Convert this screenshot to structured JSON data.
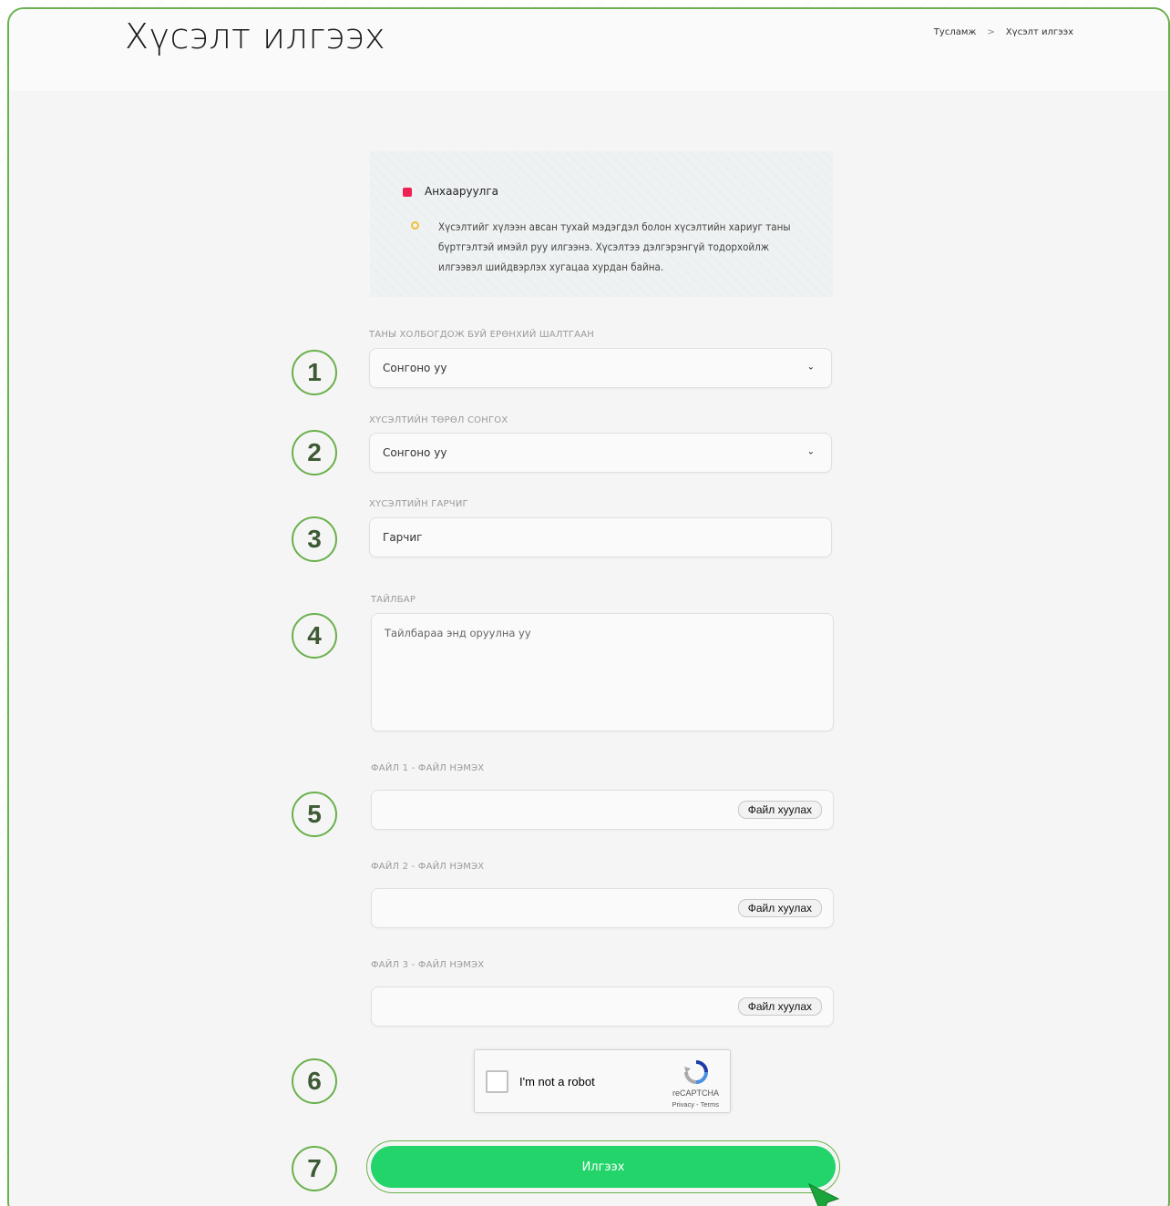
{
  "header": {
    "title": "Хүсэлт илгээх",
    "breadcrumb": {
      "home": "Тусламж",
      "current": "Хүсэлт илгээх"
    }
  },
  "notice": {
    "title": "Анхааруулга",
    "text": "Хүсэлтийг хүлээн авсан тухай мэдэгдэл болон хүсэлтийн хариуг таны бүртгэлтэй имэйл руу илгээнэ. Хүсэлтээ дэлгэрэнгүй тодорхойлж илгээвэл шийдвэрлэх хугацаа хурдан байна."
  },
  "form": {
    "channel": {
      "label": "ТАНЫ ХОЛБОГДОЖ БУЙ ЕРӨНХИЙ ШАЛТГААН",
      "value": "Сонгоно уу"
    },
    "type": {
      "label": "ХҮСЭЛТИЙН ТӨРӨЛ СОНГОХ",
      "value": "Сонгоно уу"
    },
    "subject": {
      "label": "ХҮСЭЛТИЙН ГАРЧИГ",
      "placeholder": "Гарчиг"
    },
    "description": {
      "label": "ТАЙЛБАР",
      "placeholder": "Тайлбараа энд оруулна уу"
    },
    "files": [
      {
        "label": "ФАЙЛ 1 - ФАЙЛ НЭМЭХ",
        "button": "Файл хуулах"
      },
      {
        "label": "ФАЙЛ 2 - ФАЙЛ НЭМЭХ",
        "button": "Файл хуулах"
      },
      {
        "label": "ФАЙЛ 3 - ФАЙЛ НЭМЭХ",
        "button": "Файл хуулах"
      }
    ],
    "recaptcha": {
      "label": "I'm not a robot",
      "brand": "reCAPTCHA",
      "links": "Privacy - Terms"
    },
    "submit": "Илгээх"
  },
  "steps": [
    "1",
    "2",
    "3",
    "4",
    "5",
    "6",
    "7"
  ],
  "colors": {
    "accent": "#22d46a",
    "outline": "#6ab04c",
    "notice_dot": "#ee2255",
    "notice_ring": "#f2c035"
  }
}
